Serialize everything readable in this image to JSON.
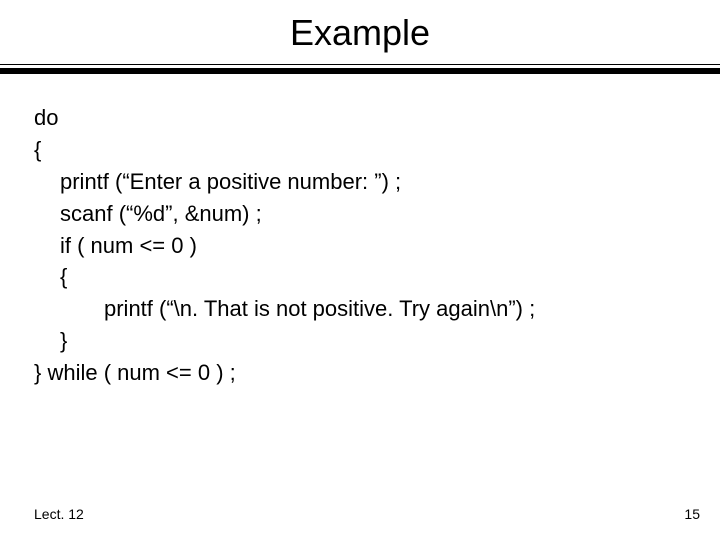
{
  "title": "Example",
  "code": {
    "l1": "do",
    "l2": "{",
    "l3": "printf (“Enter a positive number: ”) ;",
    "l4": "scanf (“%d”, &num) ;",
    "l5": "if ( num <= 0 )",
    "l6": "{",
    "l7": "printf (“\\n. That is not positive.  Try again\\n”) ;",
    "l8": "}",
    "l9": "} while ( num <= 0 ) ;"
  },
  "footer": {
    "left": "Lect. 12",
    "right": "15"
  }
}
